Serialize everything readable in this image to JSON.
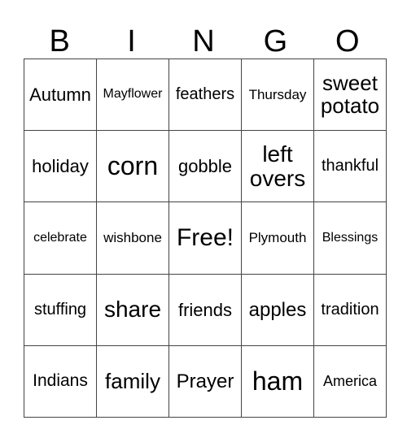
{
  "header": [
    "B",
    "I",
    "N",
    "G",
    "O"
  ],
  "rows": [
    [
      "Autumn",
      "Mayflower",
      "feathers",
      "Thursday",
      "sweet potato"
    ],
    [
      "holiday",
      "corn",
      "gobble",
      "left overs",
      "thankful"
    ],
    [
      "celebrate",
      "wishbone",
      "Free!",
      "Plymouth",
      "Blessings"
    ],
    [
      "stuffing",
      "share",
      "friends",
      "apples",
      "tradition"
    ],
    [
      "Indians",
      "family",
      "Prayer",
      "ham",
      "America"
    ]
  ]
}
